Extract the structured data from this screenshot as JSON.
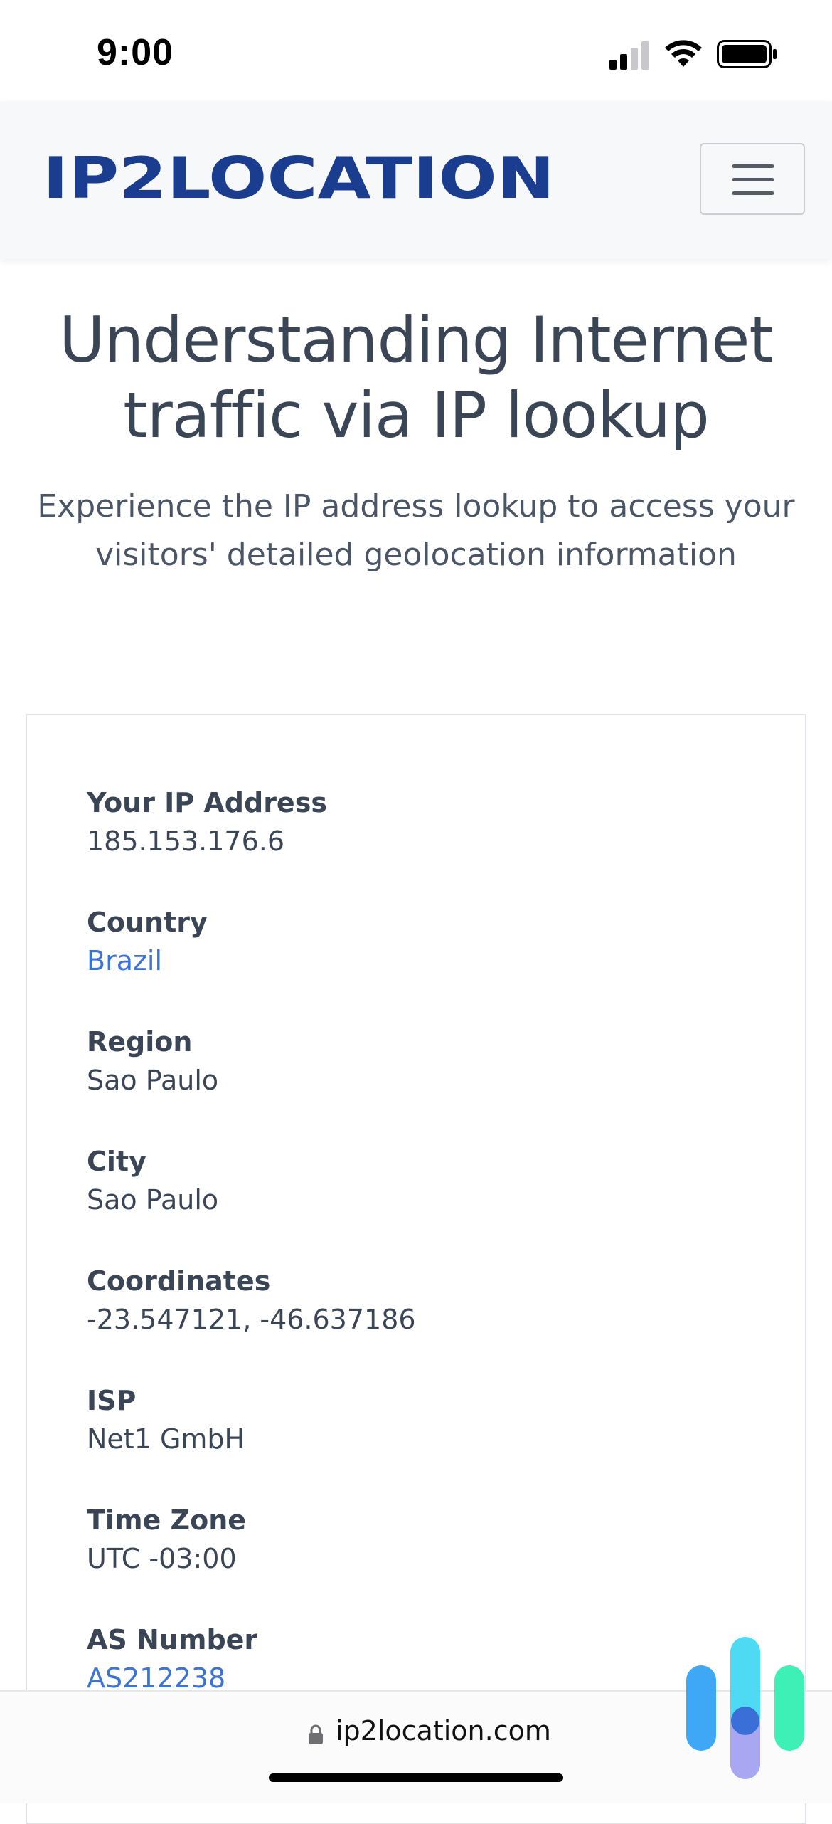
{
  "status_bar": {
    "time": "9:00"
  },
  "navbar": {
    "brand": "IP2LOCATION"
  },
  "hero": {
    "title_line1": "Understanding Internet",
    "title_line2": "traffic via IP lookup",
    "subtitle_line1": "Experience the IP address lookup to access your",
    "subtitle_line2": "visitors' detailed geolocation information"
  },
  "fields": [
    {
      "label": "Your IP Address",
      "value": "185.153.176.6"
    },
    {
      "label": "Country",
      "value": "Brazil"
    },
    {
      "label": "Region",
      "value": "Sao Paulo"
    },
    {
      "label": "City",
      "value": "Sao Paulo"
    },
    {
      "label": "Coordinates",
      "value": "-23.547121, -46.637186"
    },
    {
      "label": "ISP",
      "value": "Net1 GmbH"
    },
    {
      "label": "Time Zone",
      "value": "UTC -03:00"
    },
    {
      "label": "AS Number",
      "value": "AS212238"
    }
  ],
  "url_bar": {
    "domain": "ip2location.com"
  },
  "colors": {
    "brand_blue": "#1b3d8f",
    "link": "#3b73d6",
    "text": "#3a4556"
  }
}
